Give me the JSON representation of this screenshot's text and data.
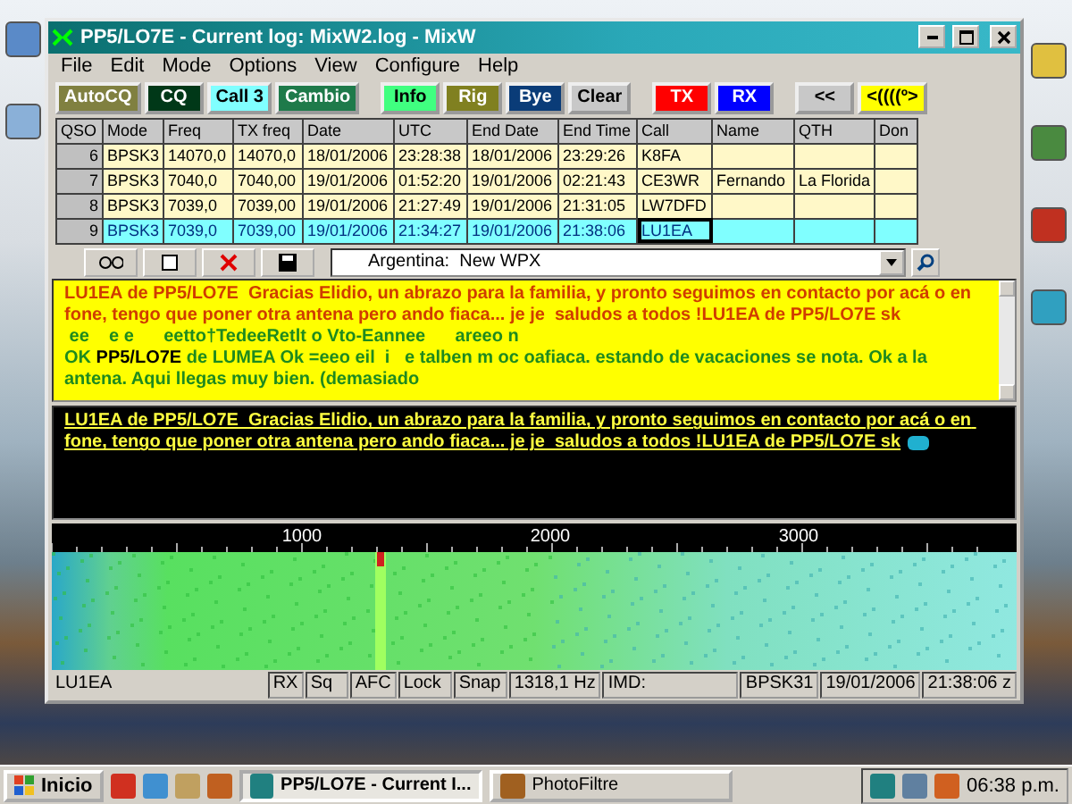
{
  "window": {
    "title": "PP5/LO7E - Current log: MixW2.log - MixW"
  },
  "menu": [
    "File",
    "Edit",
    "Mode",
    "Options",
    "View",
    "Configure",
    "Help"
  ],
  "macro_buttons": [
    {
      "label": "AutoCQ",
      "color": "#808040"
    },
    {
      "label": "CQ",
      "color": "#003818"
    },
    {
      "label": "Call 3",
      "color": "#80ffff"
    },
    {
      "label": "Cambio",
      "color": "#1e7a4a"
    },
    {
      "label": "Info",
      "color": "#40ff80"
    },
    {
      "label": "Rig",
      "color": "#808020"
    },
    {
      "label": "Bye",
      "color": "#0a3c78"
    },
    {
      "label": "Clear",
      "color": "#c8c8c8"
    },
    {
      "label": "TX",
      "color": "#ff0000"
    },
    {
      "label": "RX",
      "color": "#0000ff"
    },
    {
      "label": "<<",
      "color": "#c8c8c8"
    },
    {
      "label": "<((((º>",
      "color": "#ffff00"
    }
  ],
  "log_table": {
    "columns": [
      "QSO",
      "Mode",
      "Freq",
      "TX freq",
      "Date",
      "UTC",
      "End Date",
      "End Time",
      "Call",
      "Name",
      "QTH",
      "Don"
    ],
    "rows": [
      {
        "cells": [
          "6",
          "BPSK3",
          "14070,0",
          "14070,0",
          "18/01/2006",
          "23:28:38",
          "18/01/2006",
          "23:29:26",
          "K8FA",
          "",
          ""
        ],
        "selected": false
      },
      {
        "cells": [
          "7",
          "BPSK3",
          "7040,0",
          "7040,00",
          "19/01/2006",
          "01:52:20",
          "19/01/2006",
          "02:21:43",
          "CE3WR",
          "Fernando",
          "La Florida"
        ],
        "selected": false
      },
      {
        "cells": [
          "8",
          "BPSK3",
          "7039,0",
          "7039,00",
          "19/01/2006",
          "21:27:49",
          "19/01/2006",
          "21:31:05",
          "LW7DFD",
          "",
          ""
        ],
        "selected": false
      },
      {
        "cells": [
          "9",
          "BPSK3",
          "7039,0",
          "7039,00",
          "19/01/2006",
          "21:34:27",
          "19/01/2006",
          "21:38:06",
          "LU1EA",
          "",
          ""
        ],
        "selected": true
      }
    ]
  },
  "toolbar": {
    "combo_value": "Argentina:  New WPX"
  },
  "receive_text": [
    {
      "segments": [
        {
          "text": "LU1EA de PP5/LO7E  Gracias Elidio, un abrazo para la familia, y pronto seguimos en contacto por acá o en fone, tengo que poner otra antena pero ando fiaca... je je  saludos a todos !LU1EA de PP5/LO7E sk",
          "color": "#d03c00"
        }
      ]
    },
    {
      "segments": [
        {
          "text": " ee    e e      eetto†TedeeRetlt o Vto-Eannee      areeo n",
          "color": "#1e8a1e"
        }
      ]
    },
    {
      "segments": [
        {
          "text": "OK ",
          "color": "#1e8a1e"
        },
        {
          "text": "PP5/LO7E",
          "color": "#000000"
        },
        {
          "text": " de LUMEA Ok =eeo eil  i   e talben m oc oafiaca. estando de vacaciones se nota. Ok a la antena. Aqui llegas muy bien. (demasiado",
          "color": "#1e8a1e"
        }
      ]
    }
  ],
  "transmit_text": "LU1EA de PP5/LO7E  Gracias Elidio, un abrazo para la familia, y pronto seguimos en contacto por acá o en fone, tengo que poner otra antena pero ando fiaca... je je  saludos a todos !LU1EA de PP5/LO7E sk",
  "waterfall": {
    "scale_labels": [
      "1000",
      "2000",
      "3000"
    ]
  },
  "status_bar": {
    "call": "LU1EA",
    "cells": [
      "RX",
      "Sq",
      "AFC",
      "Lock",
      "Snap",
      "1318,1 Hz",
      "IMD:",
      "BPSK31",
      "19/01/2006",
      "21:38:06 z"
    ]
  },
  "taskbar": {
    "start": "Inicio",
    "tasks": [
      {
        "label": "PP5/LO7E - Current I...",
        "selected": true
      },
      {
        "label": "PhotoFiltre",
        "selected": false
      }
    ],
    "clock": "06:38 p.m."
  }
}
